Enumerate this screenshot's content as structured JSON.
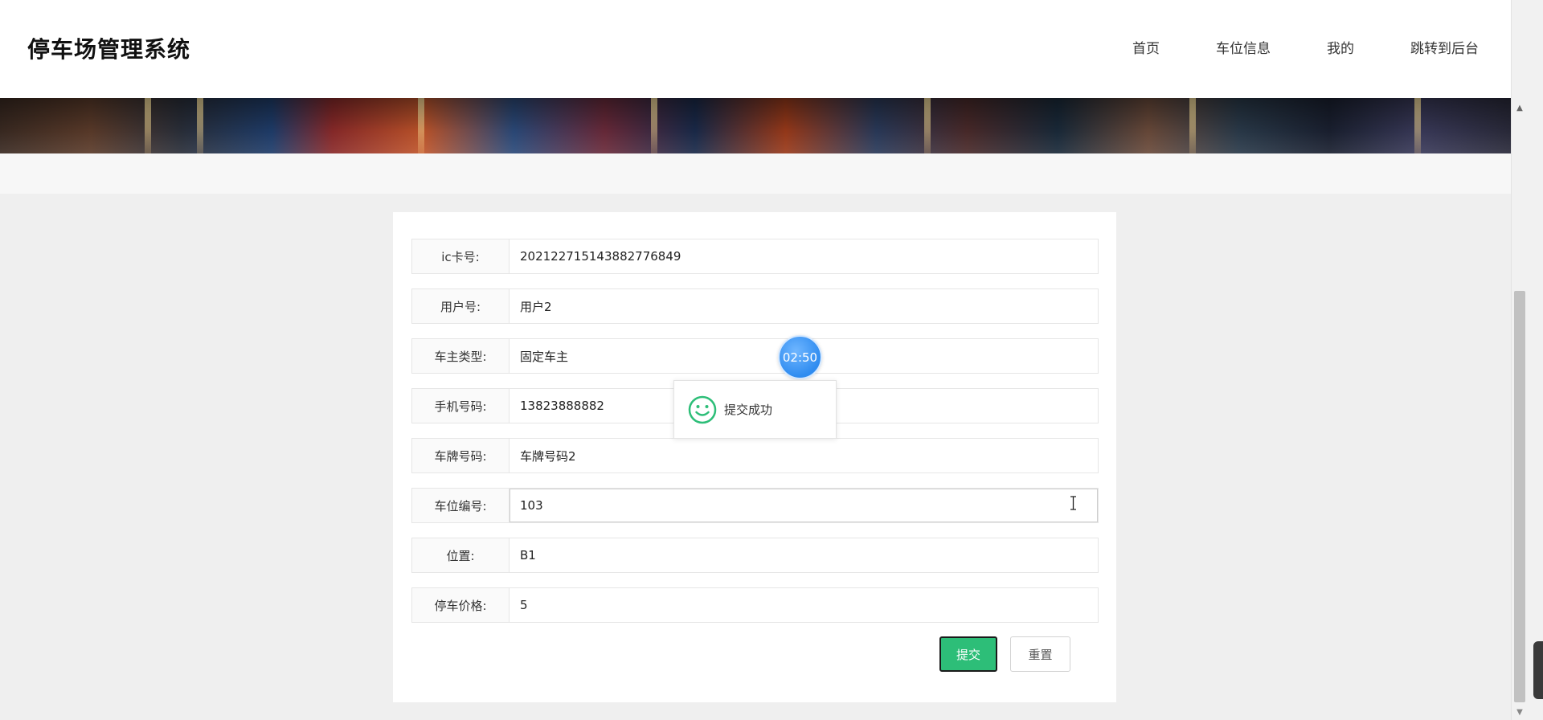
{
  "header": {
    "title": "停车场管理系统",
    "nav": [
      "首页",
      "车位信息",
      "我的",
      "跳转到后台"
    ]
  },
  "form": {
    "fields": [
      {
        "label": "ic卡号:",
        "value": "20212271514388277684​9"
      },
      {
        "label": "用户号:",
        "value": "用户2"
      },
      {
        "label": "车主类型:",
        "value": "固定车主"
      },
      {
        "label": "手机号码:",
        "value": "13823888882"
      },
      {
        "label": "车牌号码:",
        "value": "车牌号码2"
      },
      {
        "label": "车位编号:",
        "value": "103"
      },
      {
        "label": "位置:",
        "value": "B1"
      },
      {
        "label": "停车价格:",
        "value": "5"
      }
    ],
    "submit_label": "提交",
    "reset_label": "重置"
  },
  "timer": {
    "text": "02:50"
  },
  "toast": {
    "icon": "smile-icon",
    "message": "提交成功"
  },
  "colors": {
    "accent": "#2dbe78",
    "timer": "#2f8cf0"
  }
}
